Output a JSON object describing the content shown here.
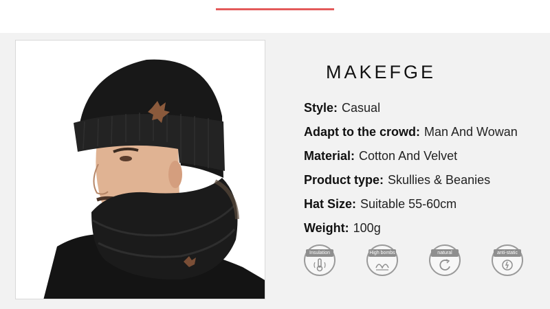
{
  "brand": "MAKEFGE",
  "specs": [
    {
      "label": "Style:",
      "value": "Casual"
    },
    {
      "label": "Adapt to the crowd:",
      "value": "Man And Wowan"
    },
    {
      "label": "Material:",
      "value": "Cotton And Velvet"
    },
    {
      "label": "Product type:",
      "value": "Skullies & Beanies"
    },
    {
      "label": "Hat Size:",
      "value": "Suitable 55-60cm"
    },
    {
      "label": "Weight:",
      "value": "100g"
    }
  ],
  "badges": [
    {
      "label": "Insulation",
      "icon": "thermometer-icon"
    },
    {
      "label": "High bombs",
      "icon": "bounce-icon"
    },
    {
      "label": "natural",
      "icon": "cycle-icon"
    },
    {
      "label": "anti-static",
      "icon": "shield-static-icon"
    }
  ],
  "colors": {
    "accent_line": "#e35a5a",
    "panel_bg": "#f2f2f2",
    "badge_gray": "#8e8e8e"
  }
}
